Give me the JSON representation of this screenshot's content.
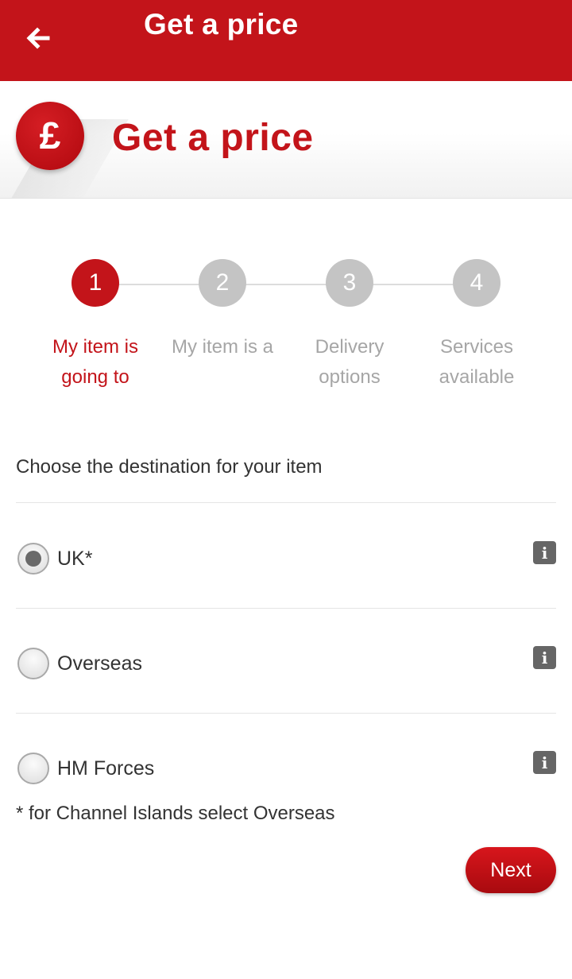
{
  "appbar": {
    "title": "Get a price",
    "back_icon": "arrow-left-icon"
  },
  "header": {
    "title": "Get a price",
    "badge_symbol": "£"
  },
  "stepper": {
    "steps": [
      {
        "number": "1",
        "label_line1": "My item is",
        "label_line2": "going to",
        "active": true
      },
      {
        "number": "2",
        "label_line1": "My item is a",
        "label_line2": "",
        "active": false
      },
      {
        "number": "3",
        "label_line1": "Delivery",
        "label_line2": "options",
        "active": false
      },
      {
        "number": "4",
        "label_line1": "Services",
        "label_line2": "available",
        "active": false
      }
    ]
  },
  "form": {
    "prompt": "Choose the destination for your item",
    "options": [
      {
        "label": "UK*",
        "selected": true,
        "info_icon": "info-icon"
      },
      {
        "label": "Overseas",
        "selected": false,
        "info_icon": "info-icon"
      },
      {
        "label": "HM Forces",
        "selected": false,
        "info_icon": "info-icon"
      }
    ],
    "info_glyph": "i",
    "footnote": "* for Channel Islands select Overseas",
    "next_label": "Next"
  },
  "colors": {
    "brand_red": "#c3141a",
    "inactive_step": "#c4c4c4"
  }
}
